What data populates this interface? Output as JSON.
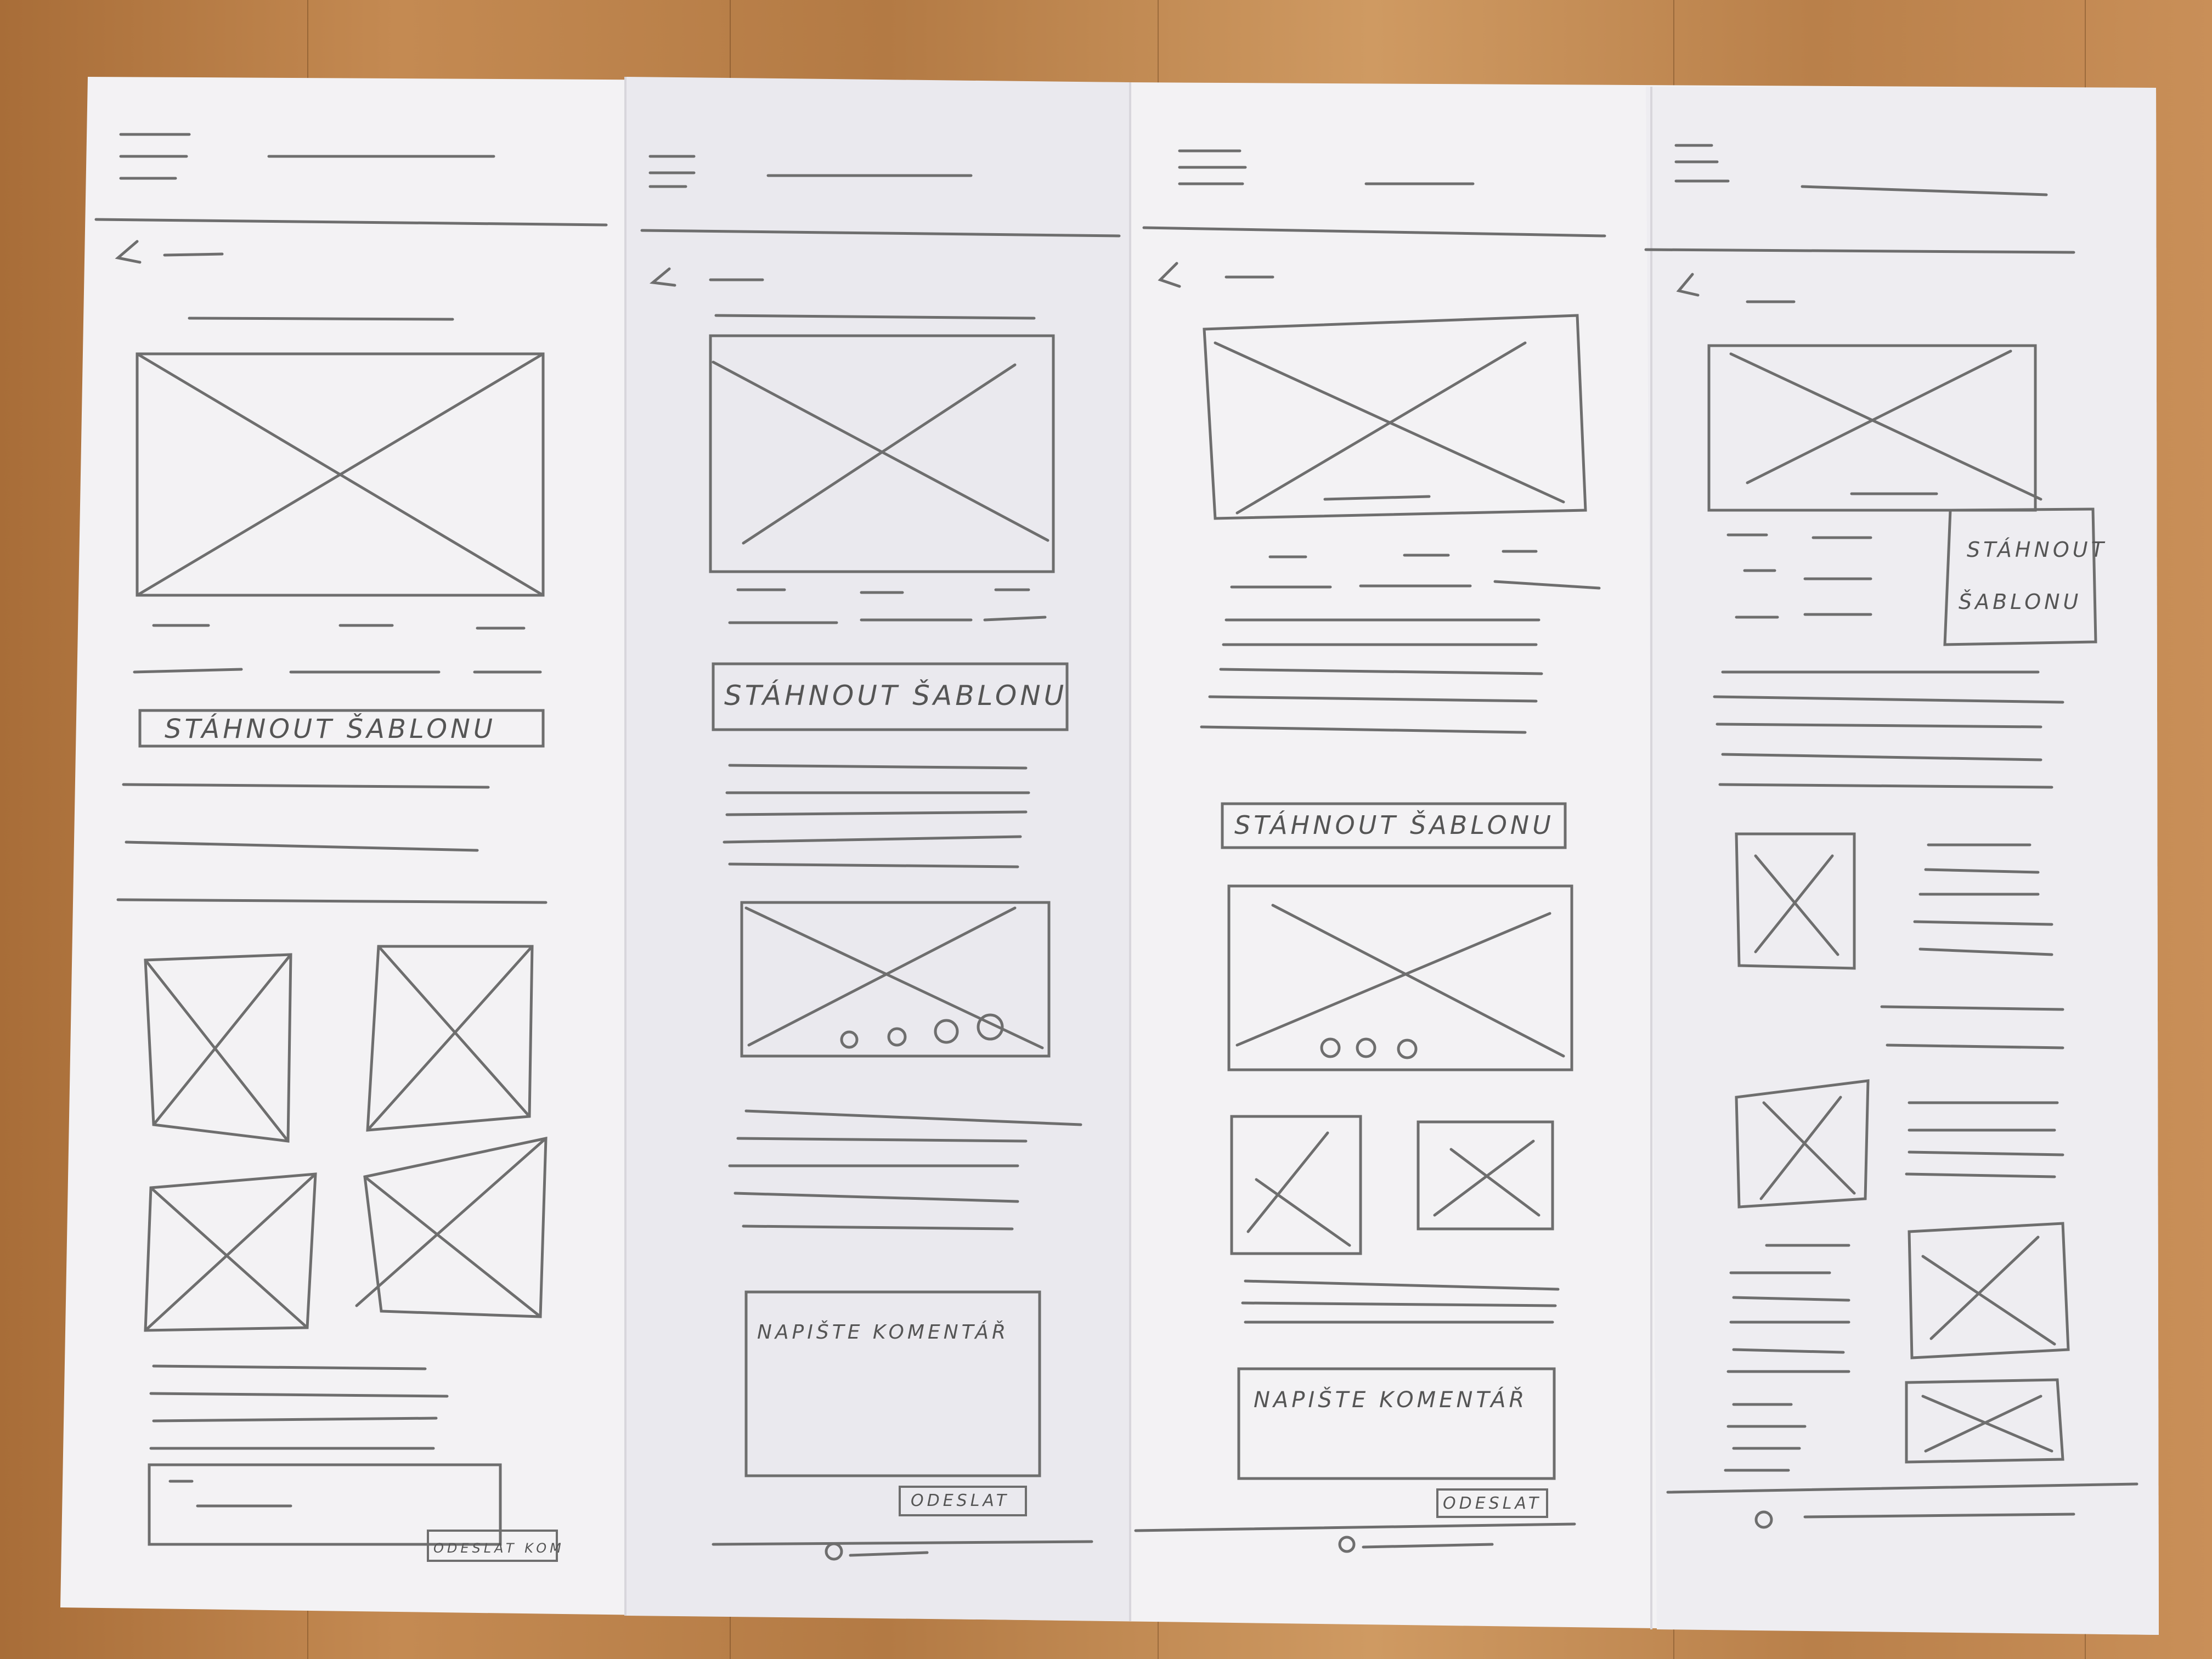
{
  "panels": [
    {
      "download_button": "STÁHNOUT ŠABLONU",
      "comment_placeholder": "",
      "send_button": "ODESLAT KOM"
    },
    {
      "download_button": "STÁHNOUT ŠABLONU",
      "comment_placeholder": "NAPIŠTE KOMENTÁŘ",
      "send_button": "ODESLAT"
    },
    {
      "download_button": "STÁHNOUT ŠABLONU",
      "comment_placeholder": "NAPIŠTE KOMENTÁŘ",
      "send_button": "ODESLAT"
    },
    {
      "download_button_line1": "STÁHNOUT",
      "download_button_line2": "ŠABLONU"
    }
  ],
  "colors": {
    "paper": "#f2f1f2",
    "pencil": "#6b6b6b",
    "wood": "#b9804a"
  },
  "icons": [
    "hamburger-menu-icon",
    "back-arrow-icon",
    "image-placeholder-icon",
    "carousel-dots-icon",
    "copyright-icon"
  ]
}
